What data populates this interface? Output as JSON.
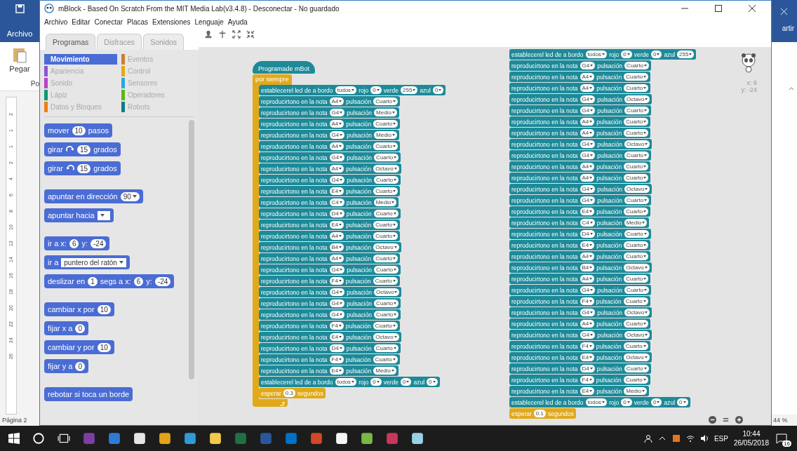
{
  "word_left": {
    "file_tab": "Archivo",
    "paste": "Pegar",
    "group_label": "Po",
    "ruler": [
      "2",
      "1",
      "1",
      "2",
      "4",
      "6",
      "8",
      "10",
      "12",
      "14",
      "16",
      "18",
      "20",
      "22",
      "24",
      "26"
    ],
    "page": "Página 2"
  },
  "word_right": {
    "file_tab": "artir",
    "zoom": "44 %"
  },
  "window": {
    "title": "mBlock - Based On Scratch From the MIT Media Lab(v3.4.8) - Desconectar - No guardado"
  },
  "menu": [
    "Archivo",
    "Editar",
    "Conectar",
    "Placas",
    "Extensiones",
    "Lenguaje",
    "Ayuda"
  ],
  "tabs": [
    {
      "label": "Programas",
      "selected": true
    },
    {
      "label": "Disfraces",
      "selected": false
    },
    {
      "label": "Sonidos",
      "selected": false
    }
  ],
  "categories": [
    {
      "label": "Movimiento",
      "color": "#4a6cd4",
      "selected": true
    },
    {
      "label": "Eventos",
      "color": "#c88330",
      "selected": false
    },
    {
      "label": "Apariencia",
      "color": "#8a55d7",
      "selected": false
    },
    {
      "label": "Control",
      "color": "#e1a91a",
      "selected": false
    },
    {
      "label": "Sonido",
      "color": "#bb42c3",
      "selected": false
    },
    {
      "label": "Sensores",
      "color": "#2ca5e2",
      "selected": false
    },
    {
      "label": "Lápiz",
      "color": "#0e9a6c",
      "selected": false
    },
    {
      "label": "Operadores",
      "color": "#5cb712",
      "selected": false
    },
    {
      "label": "Datos y Bloques",
      "color": "#ee7d16",
      "selected": false
    },
    {
      "label": "Robots",
      "color": "#0e7c8a",
      "selected": false
    }
  ],
  "palette_groups": [
    [
      {
        "kind": "motion",
        "segs": [
          {
            "kind": "text",
            "text": "mover"
          },
          {
            "kind": "number",
            "text": "10"
          },
          {
            "kind": "text",
            "text": "pasos"
          }
        ]
      },
      {
        "kind": "motion",
        "segs": [
          {
            "kind": "text",
            "text": "girar"
          },
          {
            "kind": "turn-right"
          },
          {
            "kind": "number",
            "text": "15"
          },
          {
            "kind": "text",
            "text": "grados"
          }
        ]
      },
      {
        "kind": "motion",
        "segs": [
          {
            "kind": "text",
            "text": "girar"
          },
          {
            "kind": "turn-left"
          },
          {
            "kind": "number",
            "text": "15"
          },
          {
            "kind": "text",
            "text": "grados"
          }
        ]
      }
    ],
    [
      {
        "kind": "motion",
        "segs": [
          {
            "kind": "text",
            "text": "apuntar en dirección"
          },
          {
            "kind": "dropdown",
            "text": "90"
          }
        ]
      },
      {
        "kind": "motion",
        "segs": [
          {
            "kind": "text",
            "text": "apuntar hacia"
          },
          {
            "kind": "empty-menu"
          }
        ]
      }
    ],
    [
      {
        "kind": "motion",
        "segs": [
          {
            "kind": "text",
            "text": "ir a x:"
          },
          {
            "kind": "number",
            "text": "6"
          },
          {
            "kind": "text",
            "text": "y:"
          },
          {
            "kind": "number",
            "text": "-24"
          }
        ]
      },
      {
        "kind": "motion",
        "segs": [
          {
            "kind": "text",
            "text": "ir a"
          },
          {
            "kind": "menu",
            "text": "puntero del ratón"
          }
        ]
      },
      {
        "kind": "motion",
        "segs": [
          {
            "kind": "text",
            "text": "deslizar en"
          },
          {
            "kind": "number",
            "text": "1"
          },
          {
            "kind": "text",
            "text": "segs a x:"
          },
          {
            "kind": "number",
            "text": "6"
          },
          {
            "kind": "text",
            "text": "y:"
          },
          {
            "kind": "number",
            "text": "-24"
          }
        ]
      }
    ],
    [
      {
        "kind": "motion",
        "segs": [
          {
            "kind": "text",
            "text": "cambiar x por"
          },
          {
            "kind": "number",
            "text": "10"
          }
        ]
      },
      {
        "kind": "motion",
        "segs": [
          {
            "kind": "text",
            "text": "fijar x a"
          },
          {
            "kind": "number",
            "text": "0"
          }
        ]
      },
      {
        "kind": "motion",
        "segs": [
          {
            "kind": "text",
            "text": "cambiar y por"
          },
          {
            "kind": "number",
            "text": "10"
          }
        ]
      },
      {
        "kind": "motion",
        "segs": [
          {
            "kind": "text",
            "text": "fijar y a"
          },
          {
            "kind": "number",
            "text": "0"
          }
        ]
      }
    ],
    [
      {
        "kind": "motion",
        "segs": [
          {
            "kind": "text",
            "text": "rebotar si toca un borde"
          }
        ]
      }
    ]
  ],
  "scripts": [
    {
      "hat": "Programade mBot",
      "loop": "por siempre",
      "blocks": [
        {
          "kind": "robot",
          "segs": [
            {
              "kind": "text",
              "text": "establecerel led de a bordo"
            },
            {
              "kind": "dropdown",
              "text": "todos"
            },
            {
              "kind": "text",
              "text": "rojo"
            },
            {
              "kind": "dropdown",
              "text": "0"
            },
            {
              "kind": "text",
              "text": "verde"
            },
            {
              "kind": "dropdown",
              "text": "255"
            },
            {
              "kind": "text",
              "text": "azul"
            },
            {
              "kind": "dropdown",
              "text": "0"
            }
          ]
        },
        {
          "kind": "robot",
          "segs": [
            {
              "kind": "text",
              "text": "reproducirtono en la nota"
            },
            {
              "kind": "dropdown",
              "text": "A4"
            },
            {
              "kind": "text",
              "text": "pulsación"
            },
            {
              "kind": "dropdown",
              "text": "Cuarto"
            }
          ]
        },
        {
          "kind": "robot",
          "segs": [
            {
              "kind": "text",
              "text": "reproducirtono en la nota"
            },
            {
              "kind": "dropdown",
              "text": "G4"
            },
            {
              "kind": "text",
              "text": "pulsación"
            },
            {
              "kind": "dropdown",
              "text": "Medio"
            }
          ]
        },
        {
          "kind": "robot",
          "segs": [
            {
              "kind": "text",
              "text": "reproducirtono en la nota"
            },
            {
              "kind": "dropdown",
              "text": "A4"
            },
            {
              "kind": "text",
              "text": "pulsación"
            },
            {
              "kind": "dropdown",
              "text": "Cuarto"
            }
          ]
        },
        {
          "kind": "robot",
          "segs": [
            {
              "kind": "text",
              "text": "reproducirtono en la nota"
            },
            {
              "kind": "dropdown",
              "text": "G4"
            },
            {
              "kind": "text",
              "text": "pulsación"
            },
            {
              "kind": "dropdown",
              "text": "Medio"
            }
          ]
        },
        {
          "kind": "robot",
          "segs": [
            {
              "kind": "text",
              "text": "reproducirtono en la nota"
            },
            {
              "kind": "dropdown",
              "text": "A4"
            },
            {
              "kind": "text",
              "text": "pulsación"
            },
            {
              "kind": "dropdown",
              "text": "Cuarto"
            }
          ]
        },
        {
          "kind": "robot",
          "segs": [
            {
              "kind": "text",
              "text": "reproducirtono en la nota"
            },
            {
              "kind": "dropdown",
              "text": "G4"
            },
            {
              "kind": "text",
              "text": "pulsación"
            },
            {
              "kind": "dropdown",
              "text": "Cuarto"
            }
          ]
        },
        {
          "kind": "robot",
          "segs": [
            {
              "kind": "text",
              "text": "reproducirtono en la nota"
            },
            {
              "kind": "dropdown",
              "text": "A4"
            },
            {
              "kind": "text",
              "text": "pulsación"
            },
            {
              "kind": "dropdown",
              "text": "Octavo"
            }
          ]
        },
        {
          "kind": "robot",
          "segs": [
            {
              "kind": "text",
              "text": "reproducirtono en la nota"
            },
            {
              "kind": "dropdown",
              "text": "G4"
            },
            {
              "kind": "text",
              "text": "pulsación"
            },
            {
              "kind": "dropdown",
              "text": "Cuarto"
            }
          ]
        },
        {
          "kind": "robot",
          "segs": [
            {
              "kind": "text",
              "text": "reproducirtono en la nota"
            },
            {
              "kind": "dropdown",
              "text": "E4"
            },
            {
              "kind": "text",
              "text": "pulsación"
            },
            {
              "kind": "dropdown",
              "text": "Cuarto"
            }
          ]
        },
        {
          "kind": "robot",
          "segs": [
            {
              "kind": "text",
              "text": "reproducirtono en la nota"
            },
            {
              "kind": "dropdown",
              "text": "C4"
            },
            {
              "kind": "text",
              "text": "pulsación"
            },
            {
              "kind": "dropdown",
              "text": "Medio"
            }
          ]
        },
        {
          "kind": "robot",
          "segs": [
            {
              "kind": "text",
              "text": "reproducirtono en la nota"
            },
            {
              "kind": "dropdown",
              "text": "D4"
            },
            {
              "kind": "text",
              "text": "pulsación"
            },
            {
              "kind": "dropdown",
              "text": "Cuarto"
            }
          ]
        },
        {
          "kind": "robot",
          "segs": [
            {
              "kind": "text",
              "text": "reproducirtono en la nota"
            },
            {
              "kind": "dropdown",
              "text": "E4"
            },
            {
              "kind": "text",
              "text": "pulsación"
            },
            {
              "kind": "dropdown",
              "text": "Cuarto"
            }
          ]
        },
        {
          "kind": "robot",
          "segs": [
            {
              "kind": "text",
              "text": "reproducirtono en la nota"
            },
            {
              "kind": "dropdown",
              "text": "A4"
            },
            {
              "kind": "text",
              "text": "pulsación"
            },
            {
              "kind": "dropdown",
              "text": "Cuarto"
            }
          ]
        },
        {
          "kind": "robot",
          "segs": [
            {
              "kind": "text",
              "text": "reproducirtono en la nota"
            },
            {
              "kind": "dropdown",
              "text": "B4"
            },
            {
              "kind": "text",
              "text": "pulsación"
            },
            {
              "kind": "dropdown",
              "text": "Octavo"
            }
          ]
        },
        {
          "kind": "robot",
          "segs": [
            {
              "kind": "text",
              "text": "reproducirtono en la nota"
            },
            {
              "kind": "dropdown",
              "text": "A4"
            },
            {
              "kind": "text",
              "text": "pulsación"
            },
            {
              "kind": "dropdown",
              "text": "Cuarto"
            }
          ]
        },
        {
          "kind": "robot",
          "segs": [
            {
              "kind": "text",
              "text": "reproducirtono en la nota"
            },
            {
              "kind": "dropdown",
              "text": "G4"
            },
            {
              "kind": "text",
              "text": "pulsación"
            },
            {
              "kind": "dropdown",
              "text": "Cuarto"
            }
          ]
        },
        {
          "kind": "robot",
          "segs": [
            {
              "kind": "text",
              "text": "reproducirtono en la nota"
            },
            {
              "kind": "dropdown",
              "text": "F4"
            },
            {
              "kind": "text",
              "text": "pulsación"
            },
            {
              "kind": "dropdown",
              "text": "Cuarto"
            }
          ]
        },
        {
          "kind": "robot",
          "segs": [
            {
              "kind": "text",
              "text": "reproducirtono en la nota"
            },
            {
              "kind": "dropdown",
              "text": "G4"
            },
            {
              "kind": "text",
              "text": "pulsación"
            },
            {
              "kind": "dropdown",
              "text": "Octavo"
            }
          ]
        },
        {
          "kind": "robot",
          "segs": [
            {
              "kind": "text",
              "text": "reproducirtono en la nota"
            },
            {
              "kind": "dropdown",
              "text": "G4"
            },
            {
              "kind": "text",
              "text": "pulsación"
            },
            {
              "kind": "dropdown",
              "text": "Cuarto"
            }
          ]
        },
        {
          "kind": "robot",
          "segs": [
            {
              "kind": "text",
              "text": "reproducirtono en la nota"
            },
            {
              "kind": "dropdown",
              "text": "G4"
            },
            {
              "kind": "text",
              "text": "pulsación"
            },
            {
              "kind": "dropdown",
              "text": "Cuarto"
            }
          ]
        },
        {
          "kind": "robot",
          "segs": [
            {
              "kind": "text",
              "text": "reproducirtono en la nota"
            },
            {
              "kind": "dropdown",
              "text": "F4"
            },
            {
              "kind": "text",
              "text": "pulsación"
            },
            {
              "kind": "dropdown",
              "text": "Cuarto"
            }
          ]
        },
        {
          "kind": "robot",
          "segs": [
            {
              "kind": "text",
              "text": "reproducirtono en la nota"
            },
            {
              "kind": "dropdown",
              "text": "E4"
            },
            {
              "kind": "text",
              "text": "pulsación"
            },
            {
              "kind": "dropdown",
              "text": "Octavo"
            }
          ]
        },
        {
          "kind": "robot",
          "segs": [
            {
              "kind": "text",
              "text": "reproducirtono en la nota"
            },
            {
              "kind": "dropdown",
              "text": "D4"
            },
            {
              "kind": "text",
              "text": "pulsación"
            },
            {
              "kind": "dropdown",
              "text": "Cuarto"
            }
          ]
        },
        {
          "kind": "robot",
          "segs": [
            {
              "kind": "text",
              "text": "reproducirtono en la nota"
            },
            {
              "kind": "dropdown",
              "text": "F4"
            },
            {
              "kind": "text",
              "text": "pulsación"
            },
            {
              "kind": "dropdown",
              "text": "Cuarto"
            }
          ]
        },
        {
          "kind": "robot",
          "segs": [
            {
              "kind": "text",
              "text": "reproducirtono en la nota"
            },
            {
              "kind": "dropdown",
              "text": "E4"
            },
            {
              "kind": "text",
              "text": "pulsación"
            },
            {
              "kind": "dropdown",
              "text": "Medio"
            }
          ]
        },
        {
          "kind": "robot",
          "segs": [
            {
              "kind": "text",
              "text": "establecerel led de a bordo"
            },
            {
              "kind": "dropdown",
              "text": "todos"
            },
            {
              "kind": "text",
              "text": "rojo"
            },
            {
              "kind": "dropdown",
              "text": "0"
            },
            {
              "kind": "text",
              "text": "verde"
            },
            {
              "kind": "dropdown",
              "text": "0"
            },
            {
              "kind": "text",
              "text": "azul"
            },
            {
              "kind": "dropdown",
              "text": "0"
            }
          ]
        },
        {
          "kind": "control",
          "segs": [
            {
              "kind": "text",
              "text": "esperar"
            },
            {
              "kind": "number",
              "text": "0.3"
            },
            {
              "kind": "text",
              "text": "segundos"
            }
          ]
        }
      ]
    },
    {
      "blocks": [
        {
          "kind": "robot",
          "segs": [
            {
              "kind": "text",
              "text": "establecerel led de a bordo"
            },
            {
              "kind": "dropdown",
              "text": "todos"
            },
            {
              "kind": "text",
              "text": "rojo"
            },
            {
              "kind": "dropdown",
              "text": "0"
            },
            {
              "kind": "text",
              "text": "verde"
            },
            {
              "kind": "dropdown",
              "text": "0"
            },
            {
              "kind": "text",
              "text": "azul"
            },
            {
              "kind": "dropdown",
              "text": "255"
            }
          ]
        },
        {
          "kind": "robot",
          "segs": [
            {
              "kind": "text",
              "text": "reproducirtono en la nota"
            },
            {
              "kind": "dropdown",
              "text": "G4"
            },
            {
              "kind": "text",
              "text": "pulsación"
            },
            {
              "kind": "dropdown",
              "text": "Cuarto"
            }
          ]
        },
        {
          "kind": "robot",
          "segs": [
            {
              "kind": "text",
              "text": "reproducirtono en la nota"
            },
            {
              "kind": "dropdown",
              "text": "A4"
            },
            {
              "kind": "text",
              "text": "pulsación"
            },
            {
              "kind": "dropdown",
              "text": "Cuarto"
            }
          ]
        },
        {
          "kind": "robot",
          "segs": [
            {
              "kind": "text",
              "text": "reproducirtono en la nota"
            },
            {
              "kind": "dropdown",
              "text": "A4"
            },
            {
              "kind": "text",
              "text": "pulsación"
            },
            {
              "kind": "dropdown",
              "text": "Cuarto"
            }
          ]
        },
        {
          "kind": "robot",
          "segs": [
            {
              "kind": "text",
              "text": "reproducirtono en la nota"
            },
            {
              "kind": "dropdown",
              "text": "G4"
            },
            {
              "kind": "text",
              "text": "pulsación"
            },
            {
              "kind": "dropdown",
              "text": "Octavo"
            }
          ]
        },
        {
          "kind": "robot",
          "segs": [
            {
              "kind": "text",
              "text": "reproducirtono en la nota"
            },
            {
              "kind": "dropdown",
              "text": "G4"
            },
            {
              "kind": "text",
              "text": "pulsación"
            },
            {
              "kind": "dropdown",
              "text": "Cuarto"
            }
          ]
        },
        {
          "kind": "robot",
          "segs": [
            {
              "kind": "text",
              "text": "reproducirtono en la nota"
            },
            {
              "kind": "dropdown",
              "text": "A4"
            },
            {
              "kind": "text",
              "text": "pulsación"
            },
            {
              "kind": "dropdown",
              "text": "Cuarto"
            }
          ]
        },
        {
          "kind": "robot",
          "segs": [
            {
              "kind": "text",
              "text": "reproducirtono en la nota"
            },
            {
              "kind": "dropdown",
              "text": "A4"
            },
            {
              "kind": "text",
              "text": "pulsación"
            },
            {
              "kind": "dropdown",
              "text": "Cuarto"
            }
          ]
        },
        {
          "kind": "robot",
          "segs": [
            {
              "kind": "text",
              "text": "reproducirtono en la nota"
            },
            {
              "kind": "dropdown",
              "text": "G4"
            },
            {
              "kind": "text",
              "text": "pulsación"
            },
            {
              "kind": "dropdown",
              "text": "Octavo"
            }
          ]
        },
        {
          "kind": "robot",
          "segs": [
            {
              "kind": "text",
              "text": "reproducirtono en la nota"
            },
            {
              "kind": "dropdown",
              "text": "G4"
            },
            {
              "kind": "text",
              "text": "pulsación"
            },
            {
              "kind": "dropdown",
              "text": "Cuarto"
            }
          ]
        },
        {
          "kind": "robot",
          "segs": [
            {
              "kind": "text",
              "text": "reproducirtono en la nota"
            },
            {
              "kind": "dropdown",
              "text": "A4"
            },
            {
              "kind": "text",
              "text": "pulsación"
            },
            {
              "kind": "dropdown",
              "text": "Cuarto"
            }
          ]
        },
        {
          "kind": "robot",
          "segs": [
            {
              "kind": "text",
              "text": "reproducirtono en la nota"
            },
            {
              "kind": "dropdown",
              "text": "A4"
            },
            {
              "kind": "text",
              "text": "pulsación"
            },
            {
              "kind": "dropdown",
              "text": "Cuarto"
            }
          ]
        },
        {
          "kind": "robot",
          "segs": [
            {
              "kind": "text",
              "text": "reproducirtono en la nota"
            },
            {
              "kind": "dropdown",
              "text": "G4"
            },
            {
              "kind": "text",
              "text": "pulsación"
            },
            {
              "kind": "dropdown",
              "text": "Octavo"
            }
          ]
        },
        {
          "kind": "robot",
          "segs": [
            {
              "kind": "text",
              "text": "reproducirtono en la nota"
            },
            {
              "kind": "dropdown",
              "text": "G4"
            },
            {
              "kind": "text",
              "text": "pulsación"
            },
            {
              "kind": "dropdown",
              "text": "Cuarto"
            }
          ]
        },
        {
          "kind": "robot",
          "segs": [
            {
              "kind": "text",
              "text": "reproducirtono en la nota"
            },
            {
              "kind": "dropdown",
              "text": "E4"
            },
            {
              "kind": "text",
              "text": "pulsación"
            },
            {
              "kind": "dropdown",
              "text": "Cuarto"
            }
          ]
        },
        {
          "kind": "robot",
          "segs": [
            {
              "kind": "text",
              "text": "reproducirtono en la nota"
            },
            {
              "kind": "dropdown",
              "text": "C4"
            },
            {
              "kind": "text",
              "text": "pulsación"
            },
            {
              "kind": "dropdown",
              "text": "Medio"
            }
          ]
        },
        {
          "kind": "robot",
          "segs": [
            {
              "kind": "text",
              "text": "reproducirtono en la nota"
            },
            {
              "kind": "dropdown",
              "text": "D4"
            },
            {
              "kind": "text",
              "text": "pulsación"
            },
            {
              "kind": "dropdown",
              "text": "Cuarto"
            }
          ]
        },
        {
          "kind": "robot",
          "segs": [
            {
              "kind": "text",
              "text": "reproducirtono en la nota"
            },
            {
              "kind": "dropdown",
              "text": "E4"
            },
            {
              "kind": "text",
              "text": "pulsación"
            },
            {
              "kind": "dropdown",
              "text": "Cuarto"
            }
          ]
        },
        {
          "kind": "robot",
          "segs": [
            {
              "kind": "text",
              "text": "reproducirtono en la nota"
            },
            {
              "kind": "dropdown",
              "text": "A4"
            },
            {
              "kind": "text",
              "text": "pulsación"
            },
            {
              "kind": "dropdown",
              "text": "Cuarto"
            }
          ]
        },
        {
          "kind": "robot",
          "segs": [
            {
              "kind": "text",
              "text": "reproducirtono en la nota"
            },
            {
              "kind": "dropdown",
              "text": "B4"
            },
            {
              "kind": "text",
              "text": "pulsación"
            },
            {
              "kind": "dropdown",
              "text": "Octavo"
            }
          ]
        },
        {
          "kind": "robot",
          "segs": [
            {
              "kind": "text",
              "text": "reproducirtono en la nota"
            },
            {
              "kind": "dropdown",
              "text": "A4"
            },
            {
              "kind": "text",
              "text": "pulsación"
            },
            {
              "kind": "dropdown",
              "text": "Cuarto"
            }
          ]
        },
        {
          "kind": "robot",
          "segs": [
            {
              "kind": "text",
              "text": "reproducirtono en la nota"
            },
            {
              "kind": "dropdown",
              "text": "G4"
            },
            {
              "kind": "text",
              "text": "pulsación"
            },
            {
              "kind": "dropdown",
              "text": "Cuarto"
            }
          ]
        },
        {
          "kind": "robot",
          "segs": [
            {
              "kind": "text",
              "text": "reproducirtono en la nota"
            },
            {
              "kind": "dropdown",
              "text": "F4"
            },
            {
              "kind": "text",
              "text": "pulsación"
            },
            {
              "kind": "dropdown",
              "text": "Cuarto"
            }
          ]
        },
        {
          "kind": "robot",
          "segs": [
            {
              "kind": "text",
              "text": "reproducirtono en la nota"
            },
            {
              "kind": "dropdown",
              "text": "G4"
            },
            {
              "kind": "text",
              "text": "pulsación"
            },
            {
              "kind": "dropdown",
              "text": "Octavo"
            }
          ]
        },
        {
          "kind": "robot",
          "segs": [
            {
              "kind": "text",
              "text": "reproducirtono en la nota"
            },
            {
              "kind": "dropdown",
              "text": "A4"
            },
            {
              "kind": "text",
              "text": "pulsación"
            },
            {
              "kind": "dropdown",
              "text": "Cuarto"
            }
          ]
        },
        {
          "kind": "robot",
          "segs": [
            {
              "kind": "text",
              "text": "reproducirtono en la nota"
            },
            {
              "kind": "dropdown",
              "text": "G4"
            },
            {
              "kind": "text",
              "text": "pulsación"
            },
            {
              "kind": "dropdown",
              "text": "Octavo"
            }
          ]
        },
        {
          "kind": "robot",
          "segs": [
            {
              "kind": "text",
              "text": "reproducirtono en la nota"
            },
            {
              "kind": "dropdown",
              "text": "F4"
            },
            {
              "kind": "text",
              "text": "pulsación"
            },
            {
              "kind": "dropdown",
              "text": "Cuarto"
            }
          ]
        },
        {
          "kind": "robot",
          "segs": [
            {
              "kind": "text",
              "text": "reproducirtono en la nota"
            },
            {
              "kind": "dropdown",
              "text": "E4"
            },
            {
              "kind": "text",
              "text": "pulsación"
            },
            {
              "kind": "dropdown",
              "text": "Octavo"
            }
          ]
        },
        {
          "kind": "robot",
          "segs": [
            {
              "kind": "text",
              "text": "reproducirtono en la nota"
            },
            {
              "kind": "dropdown",
              "text": "D4"
            },
            {
              "kind": "text",
              "text": "pulsación"
            },
            {
              "kind": "dropdown",
              "text": "Cuarto"
            }
          ]
        },
        {
          "kind": "robot",
          "segs": [
            {
              "kind": "text",
              "text": "reproducirtono en la nota"
            },
            {
              "kind": "dropdown",
              "text": "F4"
            },
            {
              "kind": "text",
              "text": "pulsación"
            },
            {
              "kind": "dropdown",
              "text": "Cuarto"
            }
          ]
        },
        {
          "kind": "robot",
          "segs": [
            {
              "kind": "text",
              "text": "reproducirtono en la nota"
            },
            {
              "kind": "dropdown",
              "text": "E4"
            },
            {
              "kind": "text",
              "text": "pulsación"
            },
            {
              "kind": "dropdown",
              "text": "Medio"
            }
          ]
        },
        {
          "kind": "robot",
          "segs": [
            {
              "kind": "text",
              "text": "establecerel led de a bordo"
            },
            {
              "kind": "dropdown",
              "text": "todos"
            },
            {
              "kind": "text",
              "text": "rojo"
            },
            {
              "kind": "dropdown",
              "text": "0"
            },
            {
              "kind": "text",
              "text": "verde"
            },
            {
              "kind": "dropdown",
              "text": "0"
            },
            {
              "kind": "text",
              "text": "azul"
            },
            {
              "kind": "dropdown",
              "text": "0"
            }
          ]
        },
        {
          "kind": "control",
          "segs": [
            {
              "kind": "text",
              "text": "esperar"
            },
            {
              "kind": "number",
              "text": "0.1"
            },
            {
              "kind": "text",
              "text": "segundos"
            }
          ]
        }
      ]
    }
  ],
  "sprite": {
    "x": "x: 6",
    "y": "y: -24"
  },
  "taskbar": {
    "language": "ESP",
    "time": "10:44",
    "date": "26/05/2018",
    "notifications": "16"
  }
}
